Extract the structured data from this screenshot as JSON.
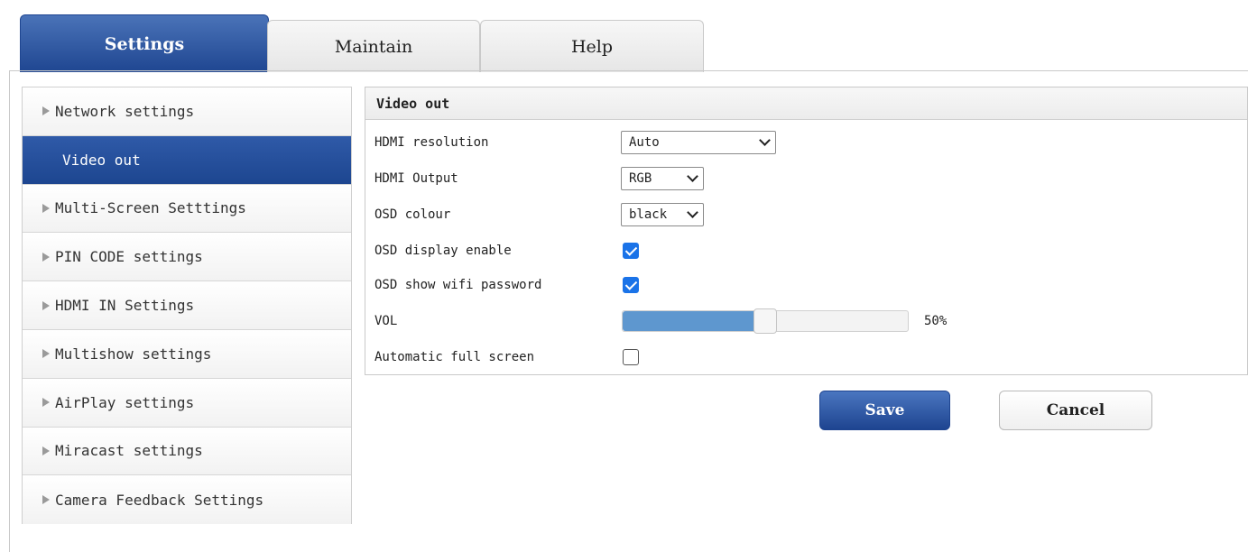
{
  "tabs": [
    {
      "label": "Settings"
    },
    {
      "label": "Maintain"
    },
    {
      "label": "Help"
    }
  ],
  "sidebar": {
    "items": [
      {
        "label": "Network settings"
      },
      {
        "label": "Video out"
      },
      {
        "label": "Multi-Screen Setttings"
      },
      {
        "label": "PIN CODE settings"
      },
      {
        "label": "HDMI IN Settings"
      },
      {
        "label": "Multishow settings"
      },
      {
        "label": "AirPlay settings"
      },
      {
        "label": "Miracast settings"
      },
      {
        "label": "Camera Feedback Settings"
      }
    ]
  },
  "panel": {
    "title": "Video out",
    "hdmi_resolution": {
      "label": "HDMI resolution",
      "value": "Auto"
    },
    "hdmi_output": {
      "label": "HDMI Output",
      "value": "RGB"
    },
    "osd_colour": {
      "label": "OSD colour",
      "value": "black"
    },
    "osd_display_enable": {
      "label": "OSD display enable",
      "checked": true
    },
    "osd_show_wifi_password": {
      "label": "OSD show wifi password",
      "checked": true
    },
    "vol": {
      "label": "VOL",
      "value": "50%",
      "fraction": 0.5
    },
    "automatic_full_screen": {
      "label": "Automatic full screen",
      "checked": false
    }
  },
  "buttons": {
    "save": "Save",
    "cancel": "Cancel"
  },
  "colors": {
    "accent": "#1f4691",
    "checkbox": "#1a73e8",
    "slider_fill": "#5e97cf"
  }
}
